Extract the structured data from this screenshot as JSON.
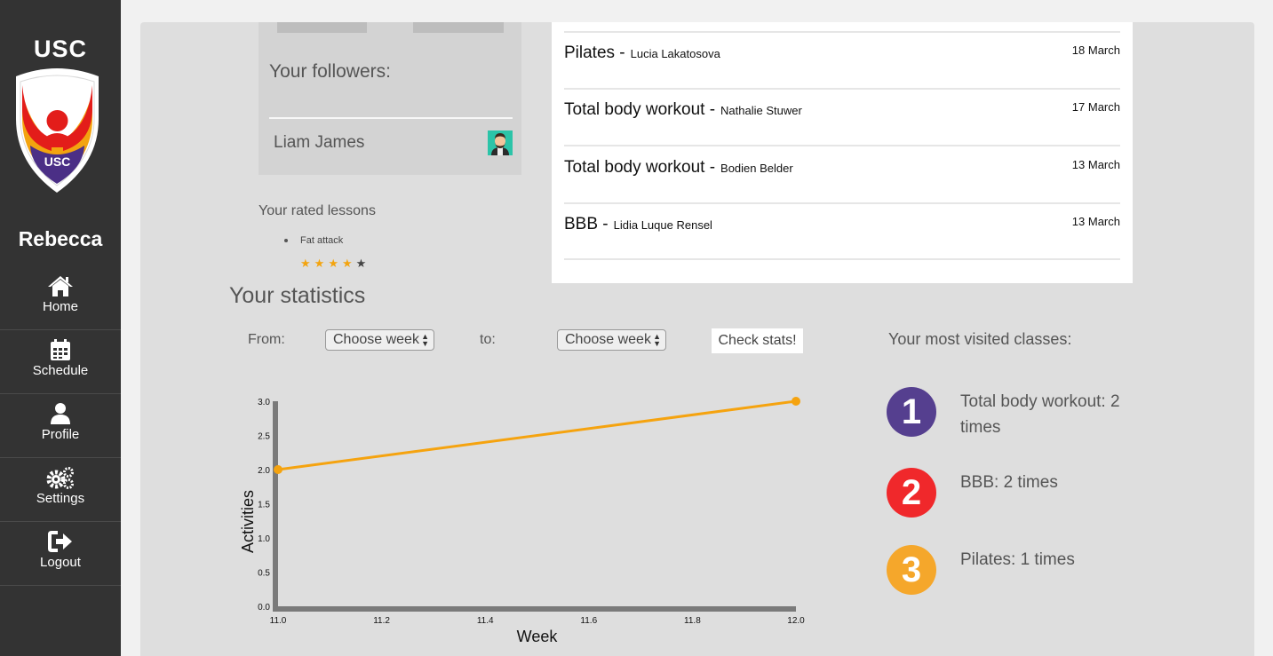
{
  "sidebar": {
    "brand": "USC",
    "logo_text": "USC",
    "username": "Rebecca",
    "items": [
      {
        "label": "Home",
        "icon": "home-icon"
      },
      {
        "label": "Schedule",
        "icon": "calendar-icon"
      },
      {
        "label": "Profile",
        "icon": "user-icon"
      },
      {
        "label": "Settings",
        "icon": "gears-icon"
      },
      {
        "label": "Logout",
        "icon": "logout-icon"
      }
    ]
  },
  "followers": {
    "title": "Your followers:",
    "items": [
      {
        "name": "Liam James",
        "avatar": "avatar-icon"
      }
    ]
  },
  "rated": {
    "title": "Your rated lessons",
    "items": [
      {
        "name": "Fat attack",
        "stars": 4,
        "max": 5
      }
    ]
  },
  "lessons": [
    {
      "name": "Pilates -",
      "instructor": "Lucia Lakatosova",
      "date": "18 March"
    },
    {
      "name": "Total body workout -",
      "instructor": "Nathalie Stuwer",
      "date": "17 March"
    },
    {
      "name": "Total body workout -",
      "instructor": "Bodien Belder",
      "date": "13 March"
    },
    {
      "name": "BBB -",
      "instructor": "Lidia Luque Rensel",
      "date": "13 March"
    }
  ],
  "stats": {
    "title": "Your statistics",
    "from_label": "From:",
    "to_label": "to:",
    "from_select": "Choose week",
    "to_select": "Choose week",
    "check_button": "Check stats!"
  },
  "chart_data": {
    "type": "line",
    "xlabel": "Week",
    "ylabel": "Activities",
    "x": [
      11.0,
      12.0
    ],
    "y": [
      2.0,
      3.0
    ],
    "xlim": [
      11.0,
      12.0
    ],
    "ylim": [
      0.0,
      3.0
    ],
    "xticks": [
      "11.0",
      "11.2",
      "11.4",
      "11.6",
      "11.8",
      "12.0"
    ],
    "yticks": [
      "0.0",
      "0.5",
      "1.0",
      "1.5",
      "2.0",
      "2.5",
      "3.0"
    ],
    "color": "#f5a30f",
    "grid": false
  },
  "most_visited": {
    "title": "Your most visited classes:",
    "items": [
      {
        "rank": "1",
        "text": "Total body workout: 2 times",
        "color": "#553f8f"
      },
      {
        "rank": "2",
        "text": "BBB: 2 times",
        "color": "#f0282b"
      },
      {
        "rank": "3",
        "text": "Pilates: 1 times",
        "color": "#f5a72b"
      }
    ]
  }
}
